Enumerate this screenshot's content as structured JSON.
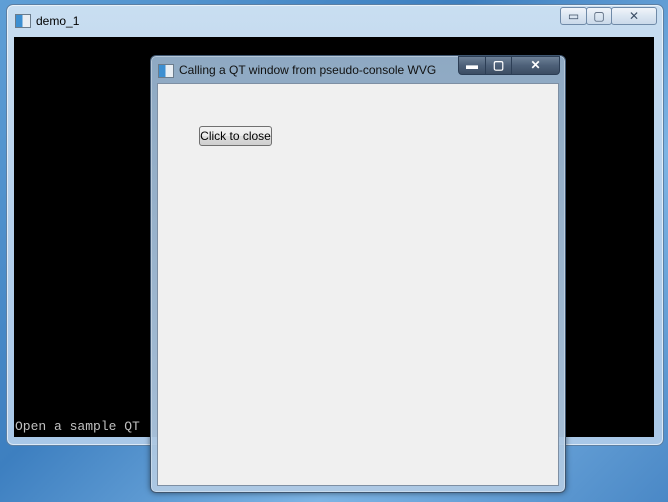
{
  "outer_window": {
    "title": "demo_1",
    "controls": {
      "minimize": "▭",
      "maximize": "▢",
      "close": "✕"
    },
    "console_text": "Open a sample QT"
  },
  "inner_window": {
    "title": "Calling a QT window from pseudo-console WVG",
    "controls": {
      "minimize": "▬",
      "maximize": "▢",
      "close": "✕"
    },
    "button_label": "Click to close"
  }
}
